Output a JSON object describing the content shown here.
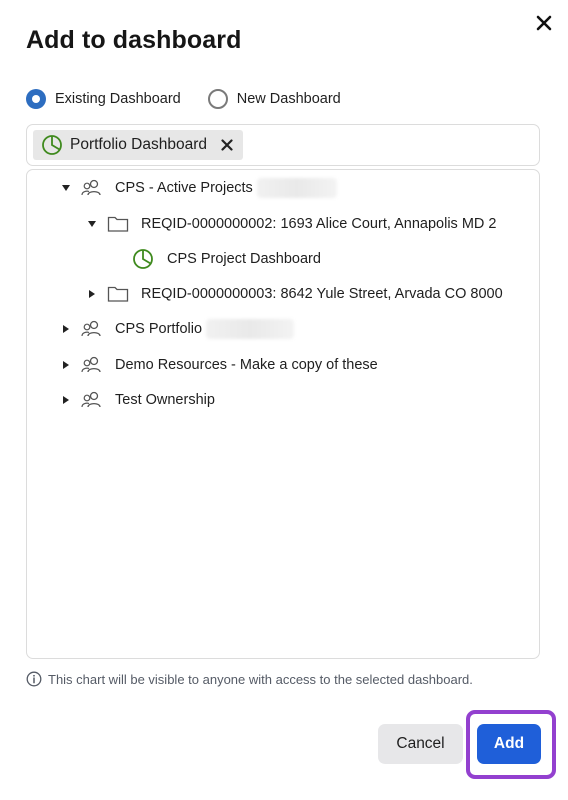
{
  "dialog": {
    "title": "Add to dashboard",
    "close_icon": "close-icon"
  },
  "radio": {
    "existing_label": "Existing Dashboard",
    "new_label": "New Dashboard",
    "selected": "Existing Dashboard"
  },
  "selected_dashboard": {
    "label": "Portfolio Dashboard",
    "icon": "dashboard-icon",
    "remove_icon": "remove-icon"
  },
  "tree": {
    "items": [
      {
        "label": "CPS - Active Projects",
        "icon": "workspace-icon",
        "expanded": true,
        "level": 0
      },
      {
        "label": "REQID-0000000002: 1693 Alice Court, Annapolis MD 2",
        "icon": "folder-icon",
        "expanded": true,
        "level": 1
      },
      {
        "label": "CPS Project Dashboard",
        "icon": "dashboard-icon",
        "level": 2
      },
      {
        "label": "REQID-0000000003: 8642 Yule Street, Arvada CO 8000",
        "icon": "folder-icon",
        "expanded": false,
        "level": 1
      },
      {
        "label": "CPS Portfolio",
        "icon": "workspace-icon",
        "expanded": false,
        "level": 0
      },
      {
        "label": "Demo Resources - Make a copy of these",
        "icon": "workspace-icon",
        "expanded": false,
        "level": 0
      },
      {
        "label": "Test Ownership",
        "icon": "workspace-icon",
        "expanded": false,
        "level": 0
      }
    ]
  },
  "info_text": "This chart will be visible to anyone with access to the selected dashboard.",
  "buttons": {
    "cancel": "Cancel",
    "add": "Add"
  },
  "colors": {
    "accent_blue": "#1f5fd9",
    "radio_blue": "#2d6dc0",
    "dashboard_green": "#3f8a1e",
    "highlight_purple": "#9340cf"
  }
}
